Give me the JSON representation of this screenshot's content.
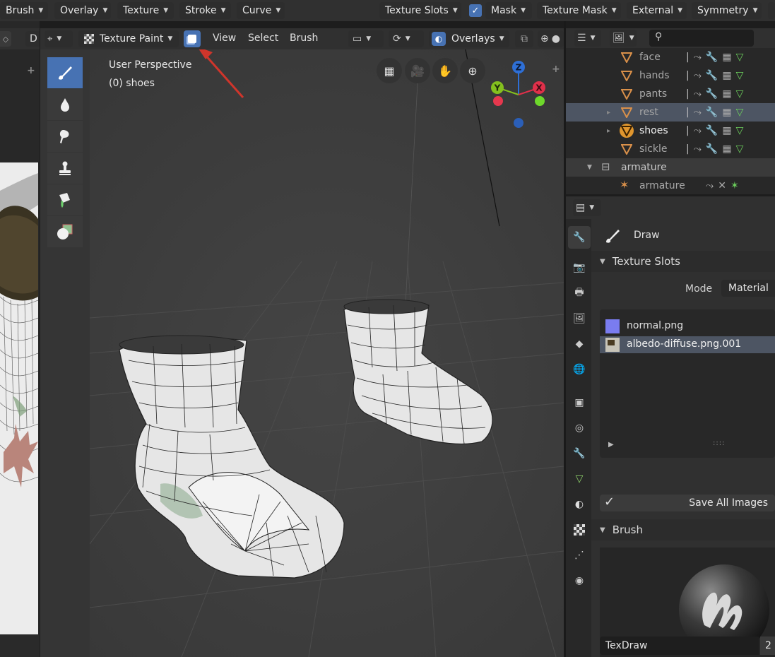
{
  "top_header": {
    "menus": [
      "Brush",
      "Overlay",
      "Texture",
      "Stroke",
      "Curve"
    ],
    "right_menus": [
      "Texture Slots",
      "Mask",
      "Texture Mask",
      "External",
      "Symmetry"
    ],
    "mask_checked": true
  },
  "left_panel": {
    "editor_letter": "D"
  },
  "viewport": {
    "mode": "Texture Paint",
    "menus": [
      "View",
      "Select",
      "Brush"
    ],
    "overlays_label": "Overlays",
    "info_line1": "User Perspective",
    "info_line2": "(0) shoes",
    "gizmo": {
      "z": "Z",
      "y": "Y",
      "x": "X"
    },
    "tools": [
      "draw",
      "soften",
      "smear",
      "clone",
      "fill",
      "mask"
    ]
  },
  "outliner": {
    "rows": [
      {
        "label": "face",
        "icon": "mesh-icon"
      },
      {
        "label": "hands",
        "icon": "mesh-icon"
      },
      {
        "label": "pants",
        "icon": "mesh-icon"
      },
      {
        "label": "rest",
        "icon": "mesh-icon",
        "highlighted": true
      },
      {
        "label": "shoes",
        "icon": "mesh-icon",
        "active": true
      },
      {
        "label": "sickle",
        "icon": "mesh-icon"
      },
      {
        "label": "armature",
        "icon": "armature-object-icon"
      },
      {
        "label": "armature",
        "icon": "armature-data-icon"
      }
    ]
  },
  "properties": {
    "tool_name": "Draw",
    "texture_slots_title": "Texture Slots",
    "mode_label": "Mode",
    "mode_value": "Material",
    "slots": [
      {
        "name": "normal.png",
        "selected": false
      },
      {
        "name": "albedo-diffuse.png.001",
        "selected": true
      }
    ],
    "save_all_label": "Save All Images",
    "brush_title": "Brush",
    "brush_name": "TexDraw",
    "brush_users": "2"
  },
  "colors": {
    "accent": "#4772b3",
    "selected_row": "#4d5563",
    "axis_x": "#e0304a",
    "axis_y": "#84c01e",
    "axis_z": "#2e6fd6",
    "arrow": "#d0352b"
  }
}
